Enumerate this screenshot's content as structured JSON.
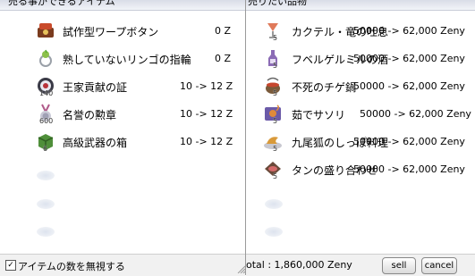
{
  "sell_panel": {
    "title": "売る事ができるアイテム",
    "items": [
      {
        "name": "試作型ワープボタン",
        "price": "0 Z",
        "qty": "",
        "icon": "warp-button-icon"
      },
      {
        "name": "熟していないリンゴの指輪",
        "price": "0 Z",
        "qty": "",
        "icon": "apple-ring-icon"
      },
      {
        "name": "王家貢献の証",
        "price": "10 -> 12 Z",
        "qty": "140",
        "icon": "royal-token-icon"
      },
      {
        "name": "名誉の勲章",
        "price": "10 -> 12 Z",
        "qty": "600",
        "icon": "medal-icon"
      },
      {
        "name": "高級武器の箱",
        "price": "10 -> 12 Z",
        "qty": "6",
        "icon": "weapon-box-icon"
      }
    ],
    "ignore_count_label": "アイテムの数を無視する",
    "ignore_count_checked": true
  },
  "cart_panel": {
    "title": "売りたい品物",
    "items": [
      {
        "name": "カクテル・竜の吐息",
        "price": "50000 -> 62,000 Zeny",
        "qty": "5",
        "icon": "cocktail-icon"
      },
      {
        "name": "フベルゲルミルの酒",
        "price": "50000 -> 62,000 Zeny",
        "qty": "5",
        "icon": "liquor-icon"
      },
      {
        "name": "不死のチゲ鍋",
        "price": "50000 -> 62,000 Zeny",
        "qty": "5",
        "icon": "stew-pot-icon"
      },
      {
        "name": "茹でサソリ",
        "price": "50000 -> 62,000 Zeny",
        "qty": "5",
        "icon": "scorpion-dish-icon"
      },
      {
        "name": "九尾狐のしっぽ料理",
        "price": "50000 -> 62,000 Zeny",
        "qty": "5",
        "icon": "fox-tail-dish-icon"
      },
      {
        "name": "タンの盛り合わせ",
        "price": "50000 -> 62,000 Zeny",
        "qty": "5",
        "icon": "tongue-platter-icon"
      }
    ],
    "total_label": "otal : 1,860,000 Zeny",
    "sell_label": "sell",
    "cancel_label": "cancel"
  }
}
